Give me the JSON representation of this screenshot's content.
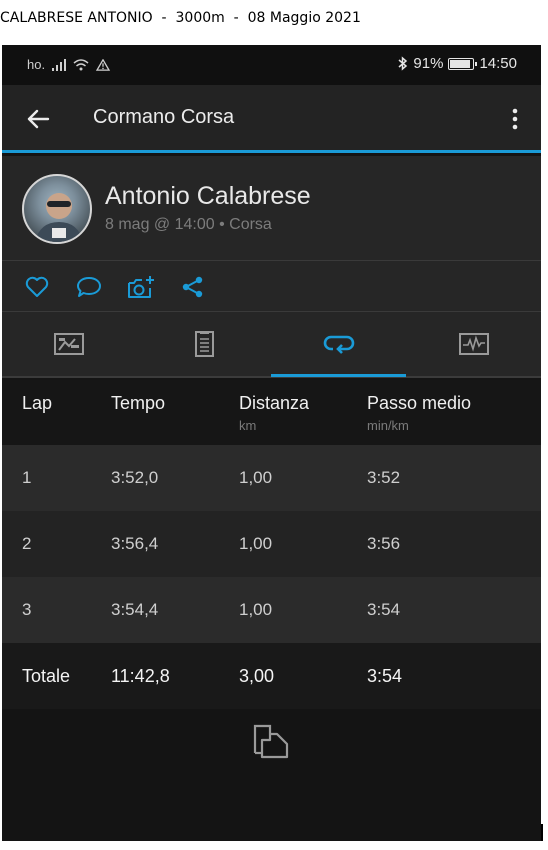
{
  "caption": "CALABRESE ANTONIO  -  3000m  -  08 Maggio 2021",
  "status_bar": {
    "carrier": "ho.",
    "battery": "91%",
    "time": "14:50",
    "icons": [
      "signal-icon",
      "wifi-icon",
      "warning-icon",
      "bluetooth-icon",
      "battery-icon"
    ]
  },
  "app_bar": {
    "title": "Cormano Corsa",
    "accent_color": "#1a9bd7"
  },
  "profile": {
    "name": "Antonio Calabrese",
    "meta": "8 mag @ 14:00 • Corsa"
  },
  "actions": [
    "like-icon",
    "comment-icon",
    "add-photo-icon",
    "share-icon"
  ],
  "tabs": [
    {
      "icon": "overview-icon",
      "selected": false
    },
    {
      "icon": "details-icon",
      "selected": false
    },
    {
      "icon": "laps-icon",
      "selected": true
    },
    {
      "icon": "charts-icon",
      "selected": false
    }
  ],
  "table": {
    "headers": [
      {
        "label": "Lap",
        "unit": ""
      },
      {
        "label": "Tempo",
        "unit": ""
      },
      {
        "label": "Distanza",
        "unit": "km"
      },
      {
        "label": "Passo medio",
        "unit": "min/km"
      }
    ],
    "rows": [
      [
        "1",
        "3:52,0",
        "1,00",
        "3:52"
      ],
      [
        "2",
        "3:56,4",
        "1,00",
        "3:56"
      ],
      [
        "3",
        "3:54,4",
        "1,00",
        "3:54"
      ]
    ],
    "total": [
      "Totale",
      "11:42,8",
      "3,00",
      "3:54"
    ]
  },
  "footer": {
    "icon": "split-view-icon"
  }
}
